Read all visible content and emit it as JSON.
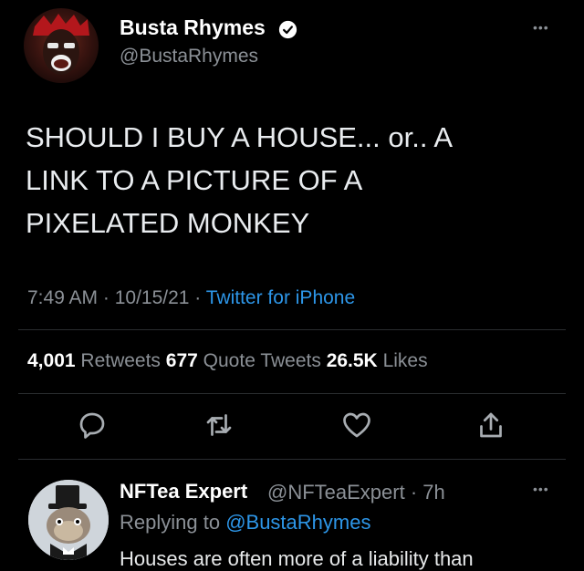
{
  "tweet": {
    "author_name": "Busta Rhymes",
    "author_handle": "@BustaRhymes",
    "more_label": "•••",
    "lines": [
      "SHOULD I BUY A HOUSE... or.. A",
      "LINK TO A PICTURE OF A",
      "PIXELATED MONKEY"
    ],
    "time": "7:49 AM · 10/15/21 · ",
    "source": "Twitter for iPhone",
    "stats": {
      "retweets_count": "4,001",
      "retweets_label": " Retweets ",
      "quotes_count": "677",
      "quotes_label": " Quote Tweets ",
      "likes_count": "26.5K",
      "likes_label": " Likes"
    },
    "actions": [
      "reply-icon",
      "retweet-icon",
      "like-icon",
      "share-icon"
    ]
  },
  "reply": {
    "author_name": "NFTea Expert",
    "author_handle_time": "@NFTeaExpert · 7h",
    "more_label": "•••",
    "replying_prefix": "Replying to ",
    "replying_mention": "@BustaRhymes",
    "text": "Houses are often more of a liability than"
  },
  "colors": {
    "background": "#000000",
    "link_blue": "#2d96e8",
    "secondary_text": "#8b9096"
  }
}
